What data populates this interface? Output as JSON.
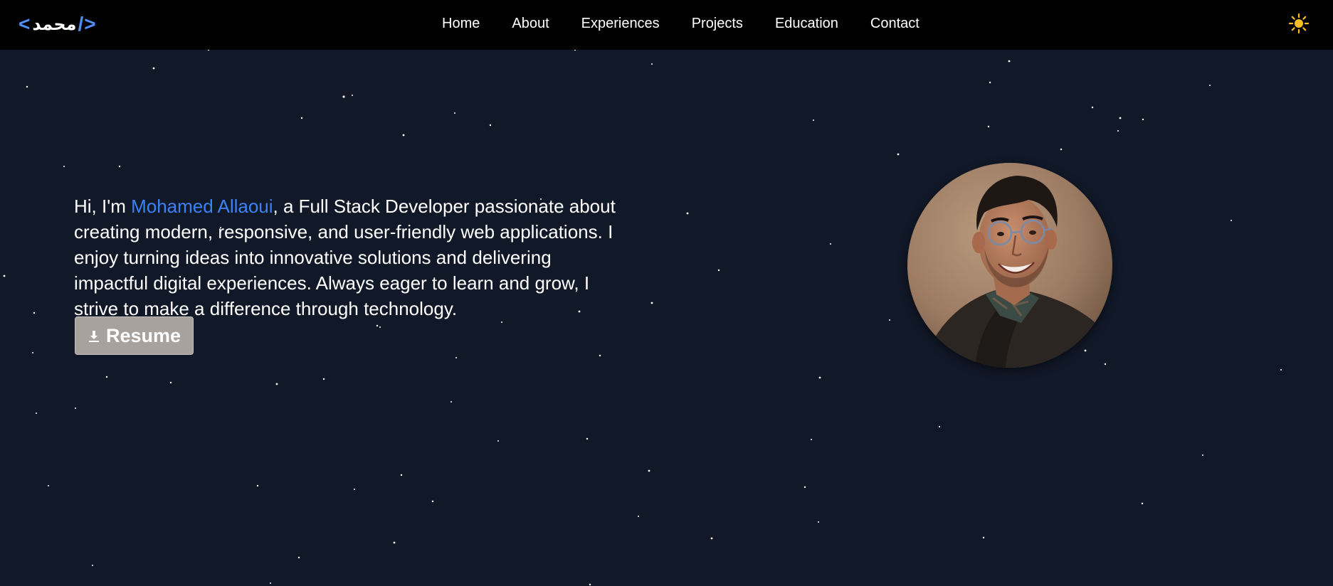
{
  "logo": {
    "open": "<",
    "mid": "محمد",
    "close": "/>"
  },
  "nav": {
    "items": [
      {
        "label": "Home"
      },
      {
        "label": "About"
      },
      {
        "label": "Experiences"
      },
      {
        "label": "Projects"
      },
      {
        "label": "Education"
      },
      {
        "label": "Contact"
      }
    ]
  },
  "theme_toggle": {
    "icon": "sun-icon",
    "color": "#fbbf24"
  },
  "hero": {
    "intro_prefix": "Hi, I'm ",
    "name": "Mohamed Allaoui",
    "intro_suffix": ", a Full Stack Developer passionate about creating modern, responsive, and user-friendly web applications. I enjoy turning ideas into innovative solutions and delivering impactful digital experiences. Always eager to learn and grow, I strive to make a difference through technology.",
    "name_color": "#3b82f6",
    "resume_button": {
      "label": "Resume",
      "icon": "download-icon"
    }
  },
  "profile": {
    "image": "profile-photo"
  },
  "colors": {
    "background": "#111827",
    "navbar": "#000000",
    "accent": "#3b82f6",
    "button": "#a8a29e"
  }
}
